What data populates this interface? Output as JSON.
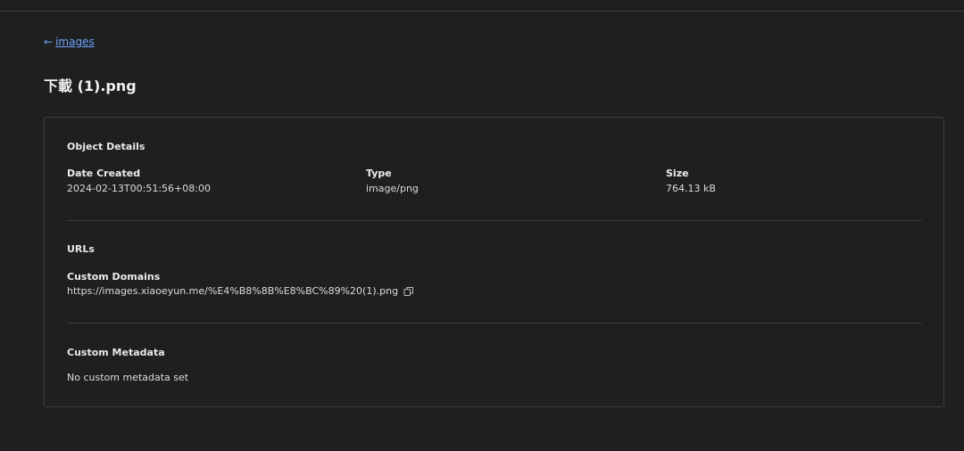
{
  "breadcrumb": {
    "back_arrow": "←",
    "back_label": "images"
  },
  "page": {
    "title": "下載 (1).png"
  },
  "object_details": {
    "section_title": "Object Details",
    "date_created_label": "Date Created",
    "date_created_value": "2024-02-13T00:51:56+08:00",
    "type_label": "Type",
    "type_value": "image/png",
    "size_label": "Size",
    "size_value": "764.13 kB"
  },
  "urls": {
    "section_title": "URLs",
    "custom_domains_label": "Custom Domains",
    "custom_domain_url": "https://images.xiaoeyun.me/%E4%B8%8B%E8%BC%89%20(1).png",
    "copy_icon": "copy-icon"
  },
  "custom_metadata": {
    "section_title": "Custom Metadata",
    "empty_text": "No custom metadata set"
  },
  "colors": {
    "background": "#1f1f1f",
    "link": "#6da3ff",
    "border": "#3d3d3d"
  }
}
